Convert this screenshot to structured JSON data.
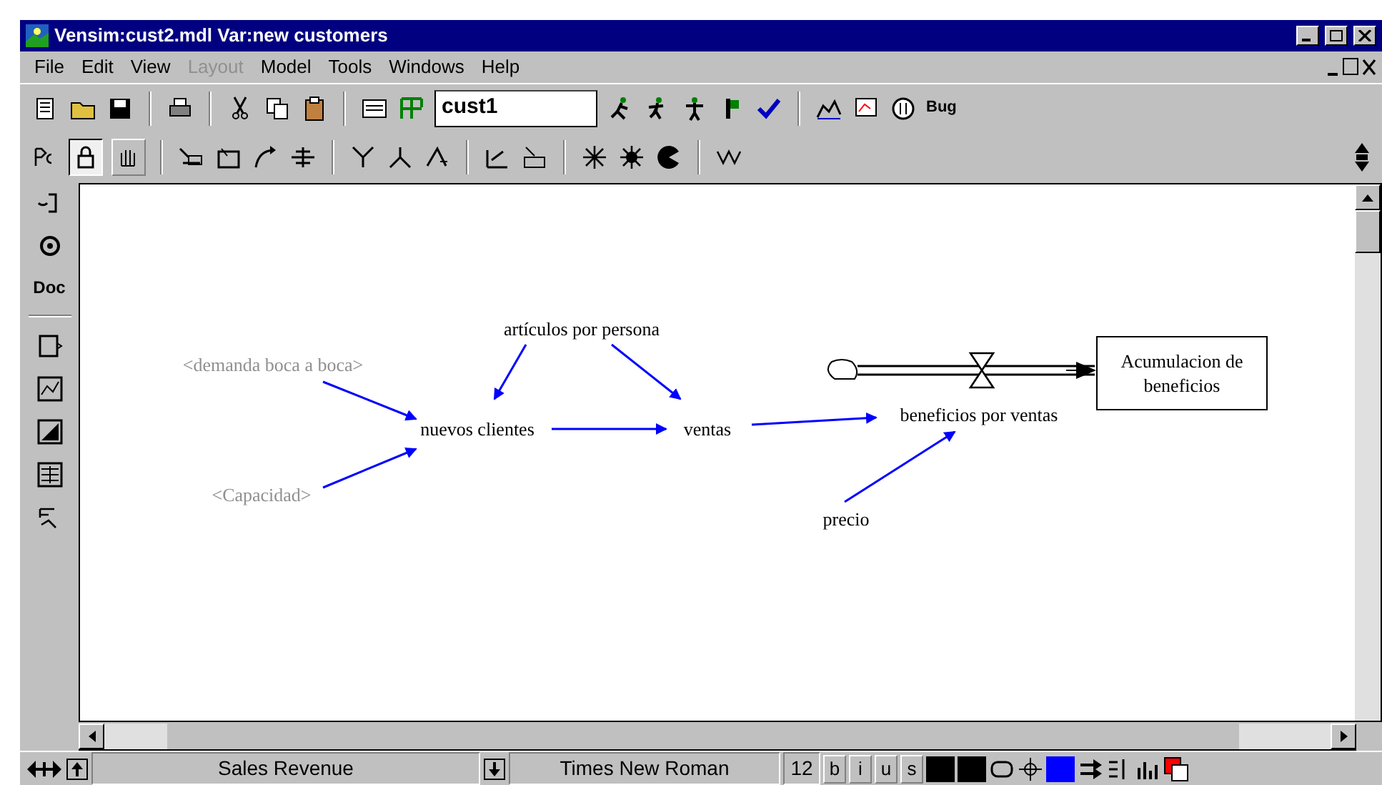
{
  "window": {
    "title": "Vensim:cust2.mdl Var:new customers"
  },
  "menu": [
    {
      "label": "File",
      "disabled": false
    },
    {
      "label": "Edit",
      "disabled": false
    },
    {
      "label": "View",
      "disabled": false
    },
    {
      "label": "Layout",
      "disabled": true
    },
    {
      "label": "Model",
      "disabled": false
    },
    {
      "label": "Tools",
      "disabled": false
    },
    {
      "label": "Windows",
      "disabled": false
    },
    {
      "label": "Help",
      "disabled": false
    }
  ],
  "toolbar": {
    "workbench_field": "cust1",
    "bug_label": "Bug"
  },
  "sketch_tools": [
    {
      "selected": true
    },
    {
      "selected": false
    }
  ],
  "side_toolbar": {
    "doc_label": "Doc"
  },
  "diagram": {
    "variables": [
      {
        "name": "<demanda boca a boca>",
        "kind": "shadow"
      },
      {
        "name": "artículos por persona",
        "kind": "aux"
      },
      {
        "name": "nuevos clientes",
        "kind": "aux"
      },
      {
        "name": "ventas",
        "kind": "aux"
      },
      {
        "name": "<Capacidad>",
        "kind": "shadow"
      },
      {
        "name": "beneficios por ventas",
        "kind": "aux"
      },
      {
        "name": "precio",
        "kind": "aux"
      },
      {
        "name": "Acumulacion de beneficios",
        "kind": "stock"
      }
    ]
  },
  "status_bar": {
    "variable": "Sales Revenue",
    "font": "Times New Roman",
    "size": "12",
    "styles": [
      "b",
      "i",
      "u",
      "s"
    ]
  }
}
